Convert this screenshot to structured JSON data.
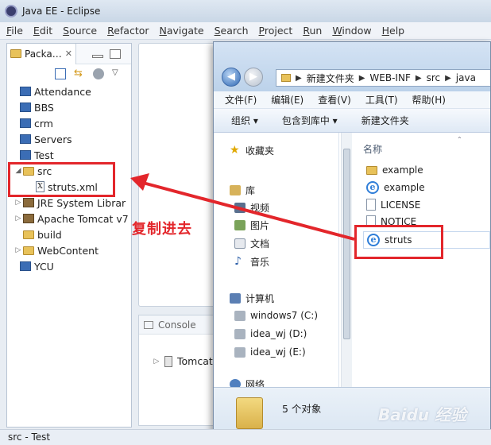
{
  "eclipse": {
    "title": "Java EE - Eclipse",
    "menu": [
      "File",
      "Edit",
      "Source",
      "Refactor",
      "Navigate",
      "Search",
      "Project",
      "Run",
      "Window",
      "Help"
    ],
    "explorer_tab": "Packa…",
    "tree": [
      {
        "label": "Attendance",
        "type": "project"
      },
      {
        "label": "BBS",
        "type": "project"
      },
      {
        "label": "crm",
        "type": "project"
      },
      {
        "label": "Servers",
        "type": "folder"
      },
      {
        "label": "Test",
        "type": "project"
      },
      {
        "label": "src",
        "type": "src",
        "expanded": true
      },
      {
        "label": "struts.xml",
        "type": "xml"
      },
      {
        "label": "JRE System Librar",
        "type": "jar"
      },
      {
        "label": "Apache Tomcat v7",
        "type": "jar"
      },
      {
        "label": "build",
        "type": "folder"
      },
      {
        "label": "WebContent",
        "type": "folder"
      },
      {
        "label": "YCU",
        "type": "project"
      }
    ],
    "console_tab": "Console",
    "console_item": "Tomcat",
    "status": "src - Test"
  },
  "explorer": {
    "breadcrumb": [
      "新建文件夹",
      "WEB-INF",
      "src",
      "java"
    ],
    "menu": [
      "文件(F)",
      "编辑(E)",
      "查看(V)",
      "工具(T)",
      "帮助(H)"
    ],
    "commands": [
      "组织 ▾",
      "包含到库中 ▾",
      "新建文件夹"
    ],
    "nav": [
      "收藏夹",
      "库",
      "视频",
      "图片",
      "文档",
      "音乐",
      "计算机",
      "windows7 (C:)",
      "idea_wj (D:)",
      "idea_wj (E:)",
      "网络"
    ],
    "column": "名称",
    "files": [
      {
        "name": "example",
        "type": "folder"
      },
      {
        "name": "example",
        "type": "ie"
      },
      {
        "name": "LICENSE",
        "type": "doc"
      },
      {
        "name": "NOTICE",
        "type": "doc"
      },
      {
        "name": "struts",
        "type": "ie"
      }
    ],
    "count": "5 个对象"
  },
  "annotation": {
    "text": "复制进去",
    "color": "#e3262b"
  },
  "watermark": "Baidu 经验"
}
